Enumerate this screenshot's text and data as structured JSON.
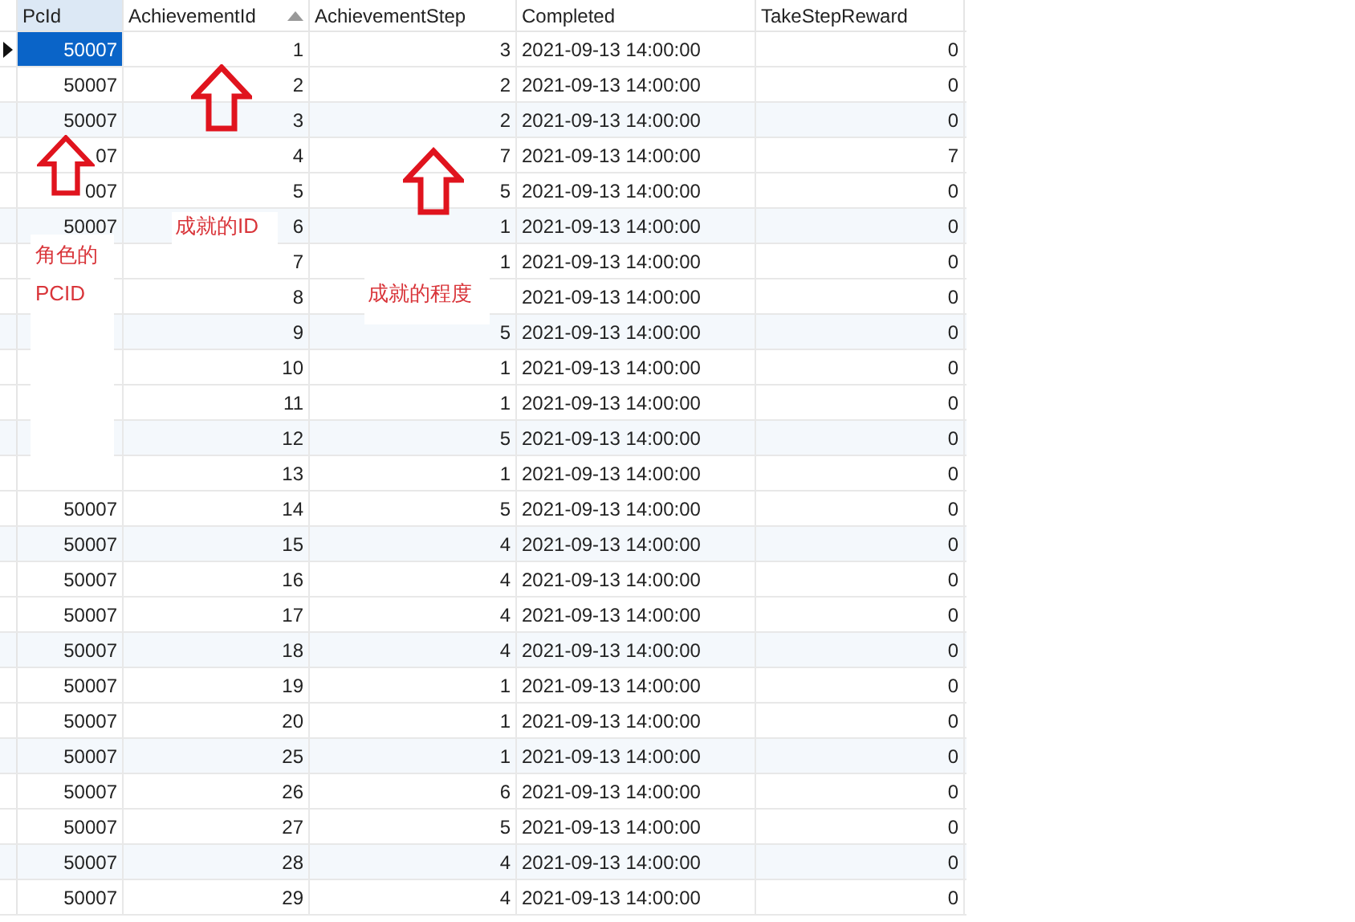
{
  "table": {
    "columns": [
      {
        "label": "PcId",
        "sorted": false,
        "selected": true
      },
      {
        "label": "AchievementId",
        "sorted": true,
        "selected": false
      },
      {
        "label": "AchievementStep",
        "sorted": false,
        "selected": false
      },
      {
        "label": "Completed",
        "sorted": false,
        "selected": false
      },
      {
        "label": "TakeStepReward",
        "sorted": false,
        "selected": false
      }
    ],
    "rows": [
      {
        "selected": true,
        "cells": [
          "50007",
          "1",
          "3",
          "2021-09-13 14:00:00",
          "0"
        ]
      },
      {
        "selected": false,
        "cells": [
          "50007",
          "2",
          "2",
          "2021-09-13 14:00:00",
          "0"
        ]
      },
      {
        "selected": false,
        "cells": [
          "50007",
          "3",
          "2",
          "2021-09-13 14:00:00",
          "0"
        ]
      },
      {
        "selected": false,
        "cells": [
          "07",
          "4",
          "7",
          "2021-09-13 14:00:00",
          "7"
        ]
      },
      {
        "selected": false,
        "cells": [
          "007",
          "5",
          "5",
          "2021-09-13 14:00:00",
          "0"
        ]
      },
      {
        "selected": false,
        "cells": [
          "50007",
          "6",
          "1",
          "2021-09-13 14:00:00",
          "0"
        ]
      },
      {
        "selected": false,
        "cells": [
          null,
          "7",
          "1",
          "2021-09-13 14:00:00",
          "0"
        ]
      },
      {
        "selected": false,
        "cells": [
          null,
          "8",
          null,
          "2021-09-13 14:00:00",
          "0"
        ]
      },
      {
        "selected": false,
        "cells": [
          null,
          "9",
          "5",
          "2021-09-13 14:00:00",
          "0"
        ]
      },
      {
        "selected": false,
        "cells": [
          null,
          "10",
          "1",
          "2021-09-13 14:00:00",
          "0"
        ]
      },
      {
        "selected": false,
        "cells": [
          null,
          "11",
          "1",
          "2021-09-13 14:00:00",
          "0"
        ]
      },
      {
        "selected": false,
        "cells": [
          null,
          "12",
          "5",
          "2021-09-13 14:00:00",
          "0"
        ]
      },
      {
        "selected": false,
        "cells": [
          null,
          "13",
          "1",
          "2021-09-13 14:00:00",
          "0"
        ]
      },
      {
        "selected": false,
        "cells": [
          "50007",
          "14",
          "5",
          "2021-09-13 14:00:00",
          "0"
        ]
      },
      {
        "selected": false,
        "cells": [
          "50007",
          "15",
          "4",
          "2021-09-13 14:00:00",
          "0"
        ]
      },
      {
        "selected": false,
        "cells": [
          "50007",
          "16",
          "4",
          "2021-09-13 14:00:00",
          "0"
        ]
      },
      {
        "selected": false,
        "cells": [
          "50007",
          "17",
          "4",
          "2021-09-13 14:00:00",
          "0"
        ]
      },
      {
        "selected": false,
        "cells": [
          "50007",
          "18",
          "4",
          "2021-09-13 14:00:00",
          "0"
        ]
      },
      {
        "selected": false,
        "cells": [
          "50007",
          "19",
          "1",
          "2021-09-13 14:00:00",
          "0"
        ]
      },
      {
        "selected": false,
        "cells": [
          "50007",
          "20",
          "1",
          "2021-09-13 14:00:00",
          "0"
        ]
      },
      {
        "selected": false,
        "cells": [
          "50007",
          "25",
          "1",
          "2021-09-13 14:00:00",
          "0"
        ]
      },
      {
        "selected": false,
        "cells": [
          "50007",
          "26",
          "6",
          "2021-09-13 14:00:00",
          "0"
        ]
      },
      {
        "selected": false,
        "cells": [
          "50007",
          "27",
          "5",
          "2021-09-13 14:00:00",
          "0"
        ]
      },
      {
        "selected": false,
        "cells": [
          "50007",
          "28",
          "4",
          "2021-09-13 14:00:00",
          "0"
        ]
      },
      {
        "selected": false,
        "cells": [
          "50007",
          "29",
          "4",
          "2021-09-13 14:00:00",
          "0"
        ]
      }
    ]
  },
  "annotations": [
    {
      "kind": "label",
      "text": "成就的ID"
    },
    {
      "kind": "label",
      "text": "角色的"
    },
    {
      "kind": "label",
      "text": "PCID"
    },
    {
      "kind": "label",
      "text": "成就的程度"
    }
  ]
}
